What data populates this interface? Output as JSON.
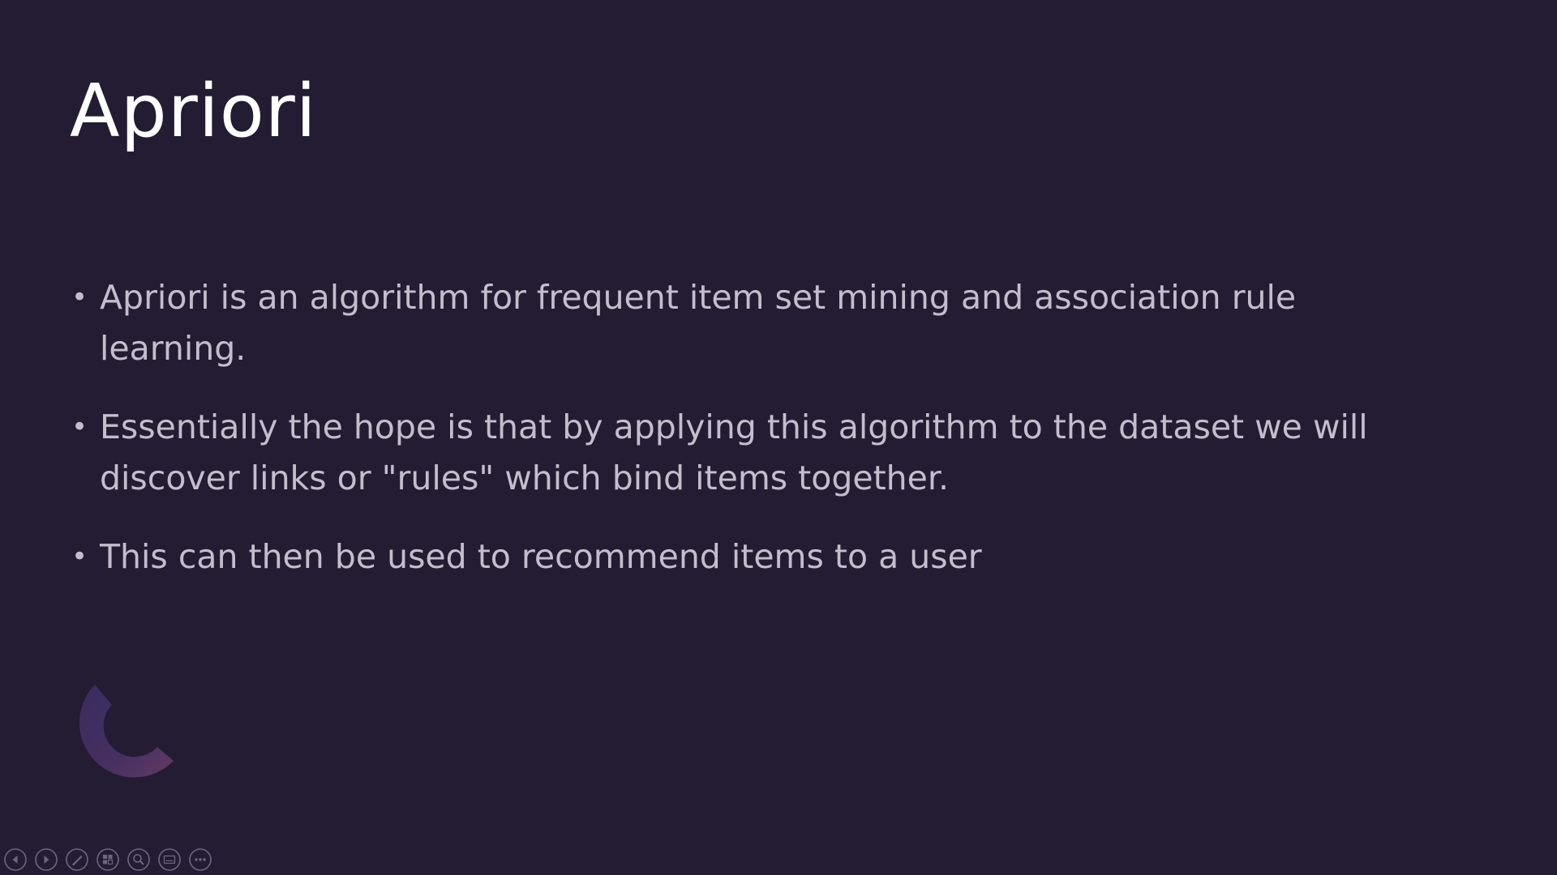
{
  "slide": {
    "title": "Apriori",
    "bullets": [
      {
        "text": "Apriori is an algorithm for frequent item set mining and association rule learning."
      },
      {
        "text": "Essentially the hope is that by applying this algorithm to the dataset we will discover links or \"rules\" which bind items together."
      },
      {
        "text": "This can then be used to recommend items to a user"
      }
    ],
    "bullet_symbol": "•"
  },
  "colors": {
    "background": "#231c33",
    "title": "#ffffff",
    "body": "#c4bdcc",
    "accent": "#5b3a6e"
  },
  "toolbar": {
    "buttons": [
      {
        "icon": "previous-icon"
      },
      {
        "icon": "next-icon"
      },
      {
        "icon": "pen-icon"
      },
      {
        "icon": "slides-grid-icon"
      },
      {
        "icon": "zoom-icon"
      },
      {
        "icon": "subtitles-icon"
      },
      {
        "icon": "more-options-icon"
      }
    ]
  }
}
